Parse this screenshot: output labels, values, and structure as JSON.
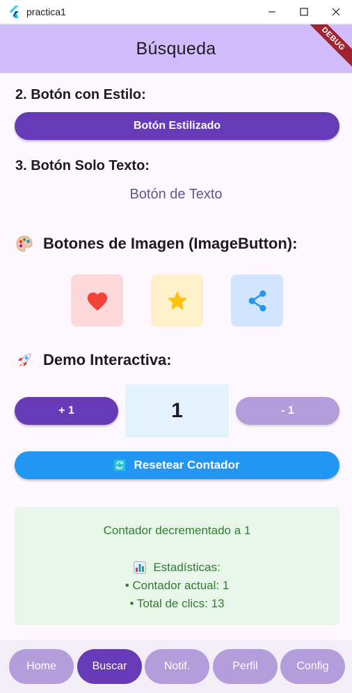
{
  "window": {
    "title": "practica1"
  },
  "appbar": {
    "title": "Búsqueda",
    "debug_label": "DEBUG"
  },
  "sections": {
    "styled_label": "2. Botón con Estilo:",
    "styled_button": "Botón Estilizado",
    "text_label": "3. Botón Solo Texto:",
    "text_button": "Botón de Texto",
    "image_buttons_title": "Botones de Imagen (ImageButton):",
    "image_buttons": [
      {
        "icon": "heart-icon",
        "color": "#f44336",
        "bg": "#fdd9dc"
      },
      {
        "icon": "star-icon",
        "color": "#ffc107",
        "bg": "#fff0cc"
      },
      {
        "icon": "share-icon",
        "color": "#2196f3",
        "bg": "#d3e5fc"
      }
    ],
    "demo_title": "Demo Interactiva:"
  },
  "counter": {
    "plus_label": "+ 1",
    "value": "1",
    "minus_label": "- 1",
    "reset_label": "Resetear Contador"
  },
  "stats": {
    "message": "Contador decrementado a 1",
    "heading": "Estadísticas:",
    "current": "• Contador actual: 1",
    "total": "• Total de clics: 13"
  },
  "nav": {
    "items": [
      "Home",
      "Buscar",
      "Notif.",
      "Perfil",
      "Config"
    ],
    "active": "Buscar"
  },
  "colors": {
    "primary": "#673ab7",
    "primary_light": "#b39ddb",
    "appbar": "#d2bdfc",
    "reset": "#2196f3",
    "stats_text": "#2e7d32"
  }
}
